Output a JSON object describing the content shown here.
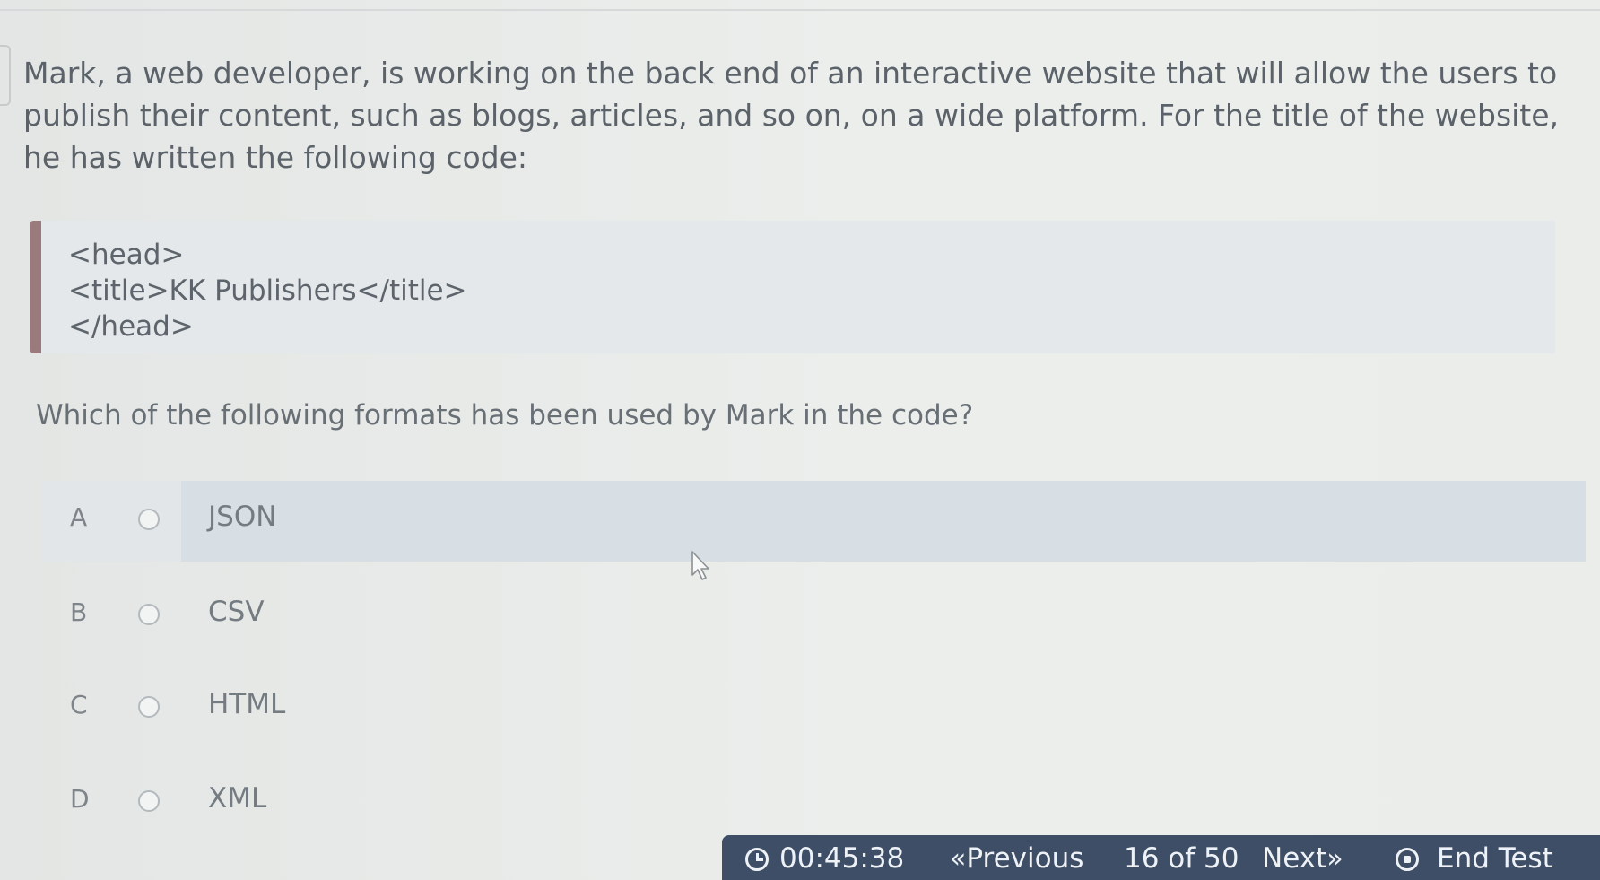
{
  "question": {
    "paragraph": "Mark, a web developer, is working on the back end of an interactive website that will allow the users to publish their content, such as blogs, articles, and so on, on a wide platform. For the title of the website, he has written the following code:",
    "code_lines": [
      "<head>",
      "<title>KK Publishers</title>",
      "</head>"
    ],
    "prompt": "Which of the following formats has been used by Mark in the code?"
  },
  "options": [
    {
      "letter": "A",
      "label": "JSON",
      "selected": true
    },
    {
      "letter": "B",
      "label": "CSV",
      "selected": false
    },
    {
      "letter": "C",
      "label": "HTML",
      "selected": false
    },
    {
      "letter": "D",
      "label": "XML",
      "selected": false
    }
  ],
  "nav": {
    "timer": "00:45:38",
    "previous_label": "Previous",
    "previous_glyph": "«",
    "progress": "16 of 50",
    "next_label": "Next",
    "next_glyph": "»",
    "end_label": "End Test"
  },
  "icons": {
    "timer": "clock-icon",
    "previous": "double-chevron-left-icon",
    "next": "double-chevron-right-icon",
    "end": "stop-icon",
    "pointer": "mouse-cursor-icon"
  },
  "colors": {
    "nav_bar": "#3d4e66",
    "code_accent": "#9b7a7d",
    "selected_option": "#d7dfe4"
  }
}
